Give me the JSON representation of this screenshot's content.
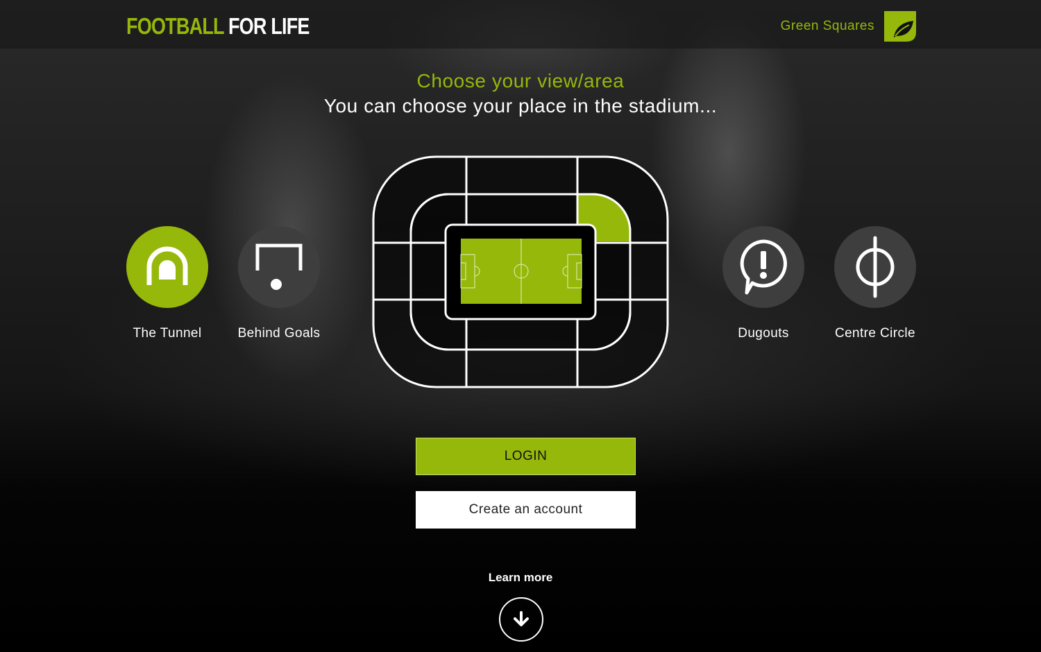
{
  "header": {
    "brand_part1": "FOOTBALL",
    "brand_part2": "FOR LIFE",
    "partner_name": "Green Squares",
    "partner_logo_icon": "leaf-square-icon"
  },
  "intro": {
    "title": "Choose your view/area",
    "subtitle": "You can choose your place in the stadium..."
  },
  "views": [
    {
      "label": "The Tunnel",
      "icon": "tunnel-icon",
      "active": true
    },
    {
      "label": "Behind Goals",
      "icon": "goal-icon",
      "active": false
    },
    {
      "label": "Dugouts",
      "icon": "alert-bubble-icon",
      "active": false
    },
    {
      "label": "Centre Circle",
      "icon": "centre-circle-icon",
      "active": false
    }
  ],
  "stadium_map": {
    "selected_section": "upper-right-corner"
  },
  "actions": {
    "login_label": "LOGIN",
    "create_account_label": "Create an account"
  },
  "footer": {
    "learn_more_label": "Learn more",
    "scroll_icon": "arrow-down-icon"
  },
  "colors": {
    "accent": "#95b80a",
    "inactive_circle": "#3e3e3e",
    "background": "#0b0b0b"
  }
}
